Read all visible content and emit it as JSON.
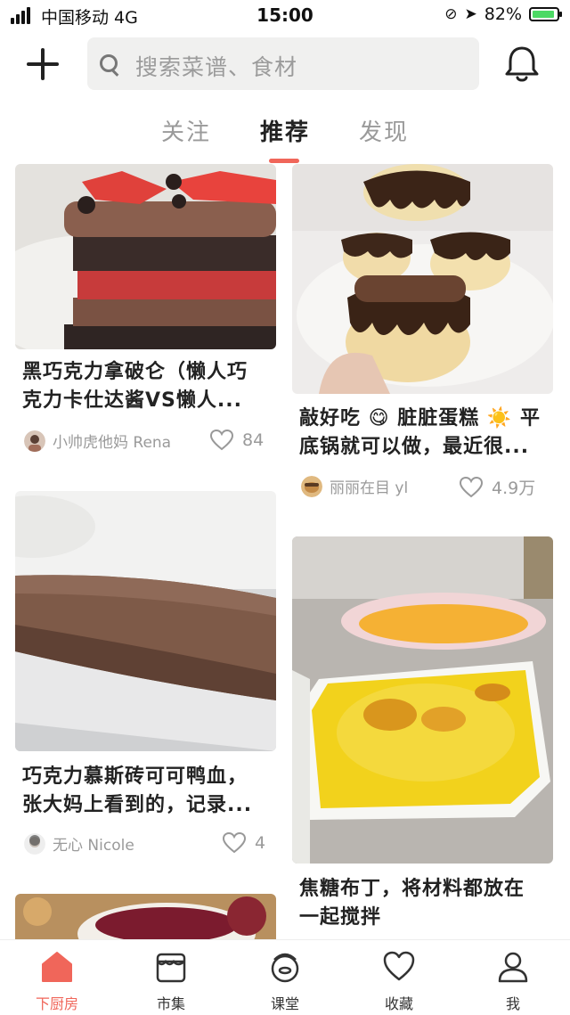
{
  "status_bar": {
    "carrier": "中国移动 4G",
    "time": "15:00",
    "battery": "82%"
  },
  "header": {
    "search_placeholder": "搜索菜谱、食材",
    "icons": [
      "plus-icon",
      "search-icon",
      "bell-icon"
    ]
  },
  "tabs": [
    {
      "label": "关注"
    },
    {
      "label": "推荐",
      "active": true
    },
    {
      "label": "发现"
    }
  ],
  "feed": {
    "cards": [
      {
        "title_line1": "黑巧克力拿破仑（懒人巧",
        "title_line2": "克力卡仕达酱VS懒人...",
        "author": "小帅虎他妈 Rena",
        "likes": "84"
      },
      {
        "title_line1": "敲好吃 😋 脏脏蛋糕 ☀️ 平",
        "title_line2": "底锅就可以做，最近很...",
        "author": "丽丽在目 yl",
        "likes": "4.9万"
      },
      {
        "title_line1": "巧克力慕斯砖可可鸭血，",
        "title_line2": "张大妈上看到的，记录...",
        "author": "无心 Nicole",
        "likes": "4"
      },
      {
        "title_line1": "焦糖布丁，将材料都放在",
        "title_line2": "一起搅拌"
      }
    ]
  },
  "bottom_nav": [
    {
      "label": "下厨房",
      "icon": "home-icon",
      "active": true
    },
    {
      "label": "市集",
      "icon": "market-icon"
    },
    {
      "label": "课堂",
      "icon": "classroom-icon"
    },
    {
      "label": "收藏",
      "icon": "heart-icon"
    },
    {
      "label": "我",
      "icon": "profile-icon"
    }
  ],
  "colors": {
    "accent": "#f0665a",
    "text": "#222222",
    "muted": "#9a9a9a"
  }
}
